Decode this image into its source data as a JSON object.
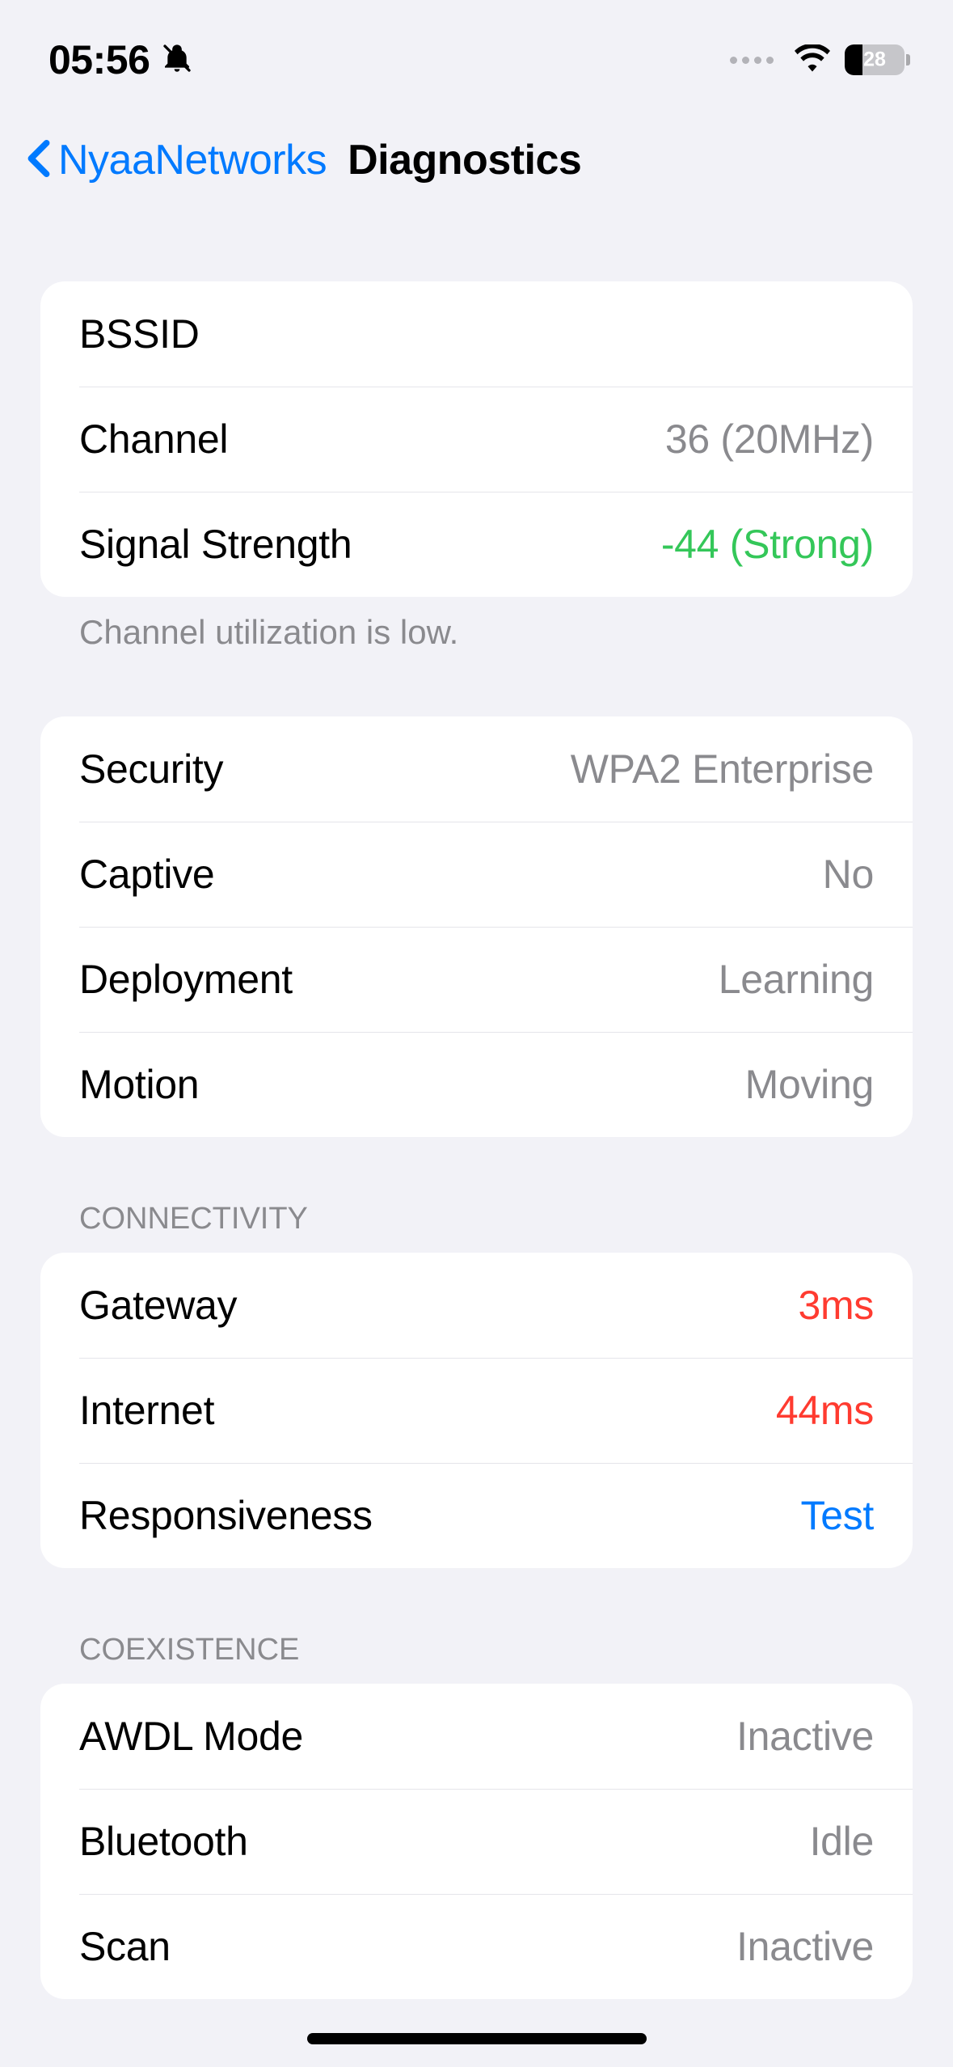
{
  "status": {
    "time": "05:56",
    "battery": "28"
  },
  "nav": {
    "back": "NyaaNetworks",
    "title": "Diagnostics"
  },
  "group1": {
    "rows": [
      {
        "label": "BSSID",
        "value": ""
      },
      {
        "label": "Channel",
        "value": "36 (20MHz)"
      },
      {
        "label": "Signal Strength",
        "value": "-44 (Strong)"
      }
    ],
    "footer": "Channel utilization is low."
  },
  "group2": {
    "rows": [
      {
        "label": "Security",
        "value": "WPA2 Enterprise"
      },
      {
        "label": "Captive",
        "value": "No"
      },
      {
        "label": "Deployment",
        "value": "Learning"
      },
      {
        "label": "Motion",
        "value": "Moving"
      }
    ]
  },
  "group3": {
    "header": "CONNECTIVITY",
    "rows": [
      {
        "label": "Gateway",
        "value": "3ms"
      },
      {
        "label": "Internet",
        "value": "44ms"
      },
      {
        "label": "Responsiveness",
        "value": "Test"
      }
    ]
  },
  "group4": {
    "header": "COEXISTENCE",
    "rows": [
      {
        "label": "AWDL Mode",
        "value": "Inactive"
      },
      {
        "label": "Bluetooth",
        "value": "Idle"
      },
      {
        "label": "Scan",
        "value": "Inactive"
      }
    ]
  }
}
